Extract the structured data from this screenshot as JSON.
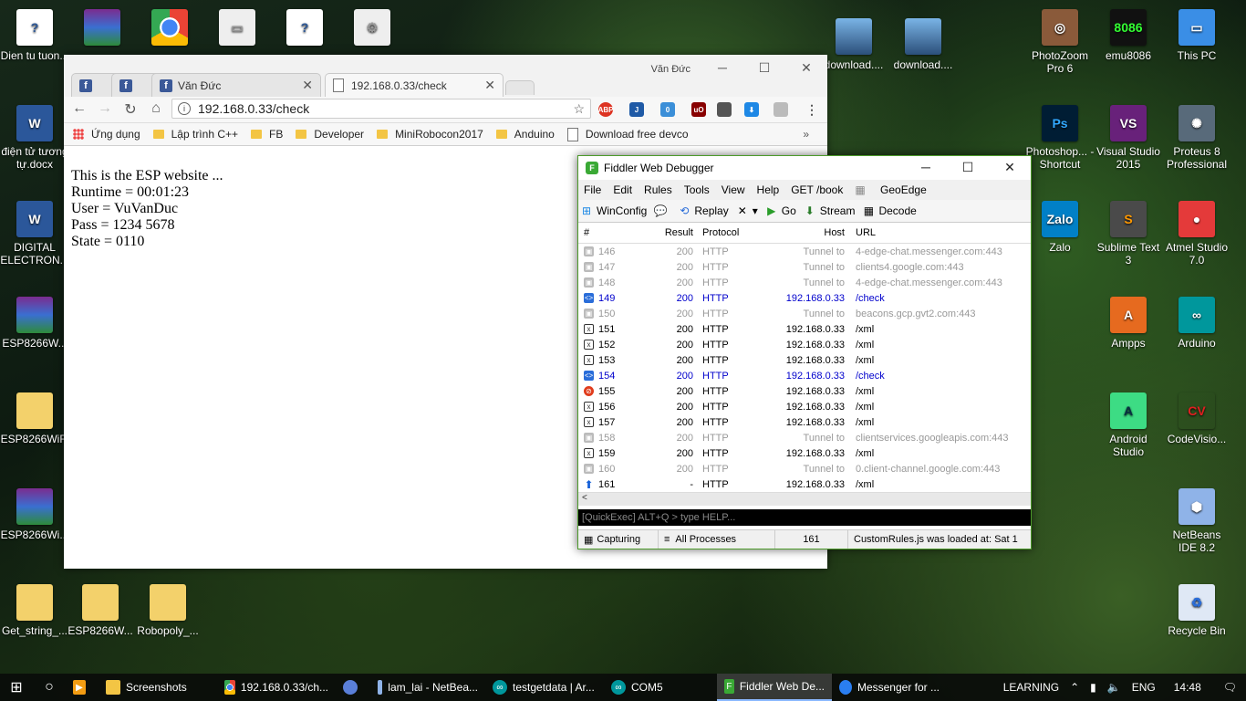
{
  "desktop_left": [
    {
      "label": "Dien tu tuon...",
      "icon": "text-document-icon"
    },
    {
      "label": "điện tử tương tự.docx",
      "icon": "word-document-icon"
    },
    {
      "label": "DIGITAL ELECTRON...",
      "icon": "word-document-icon"
    },
    {
      "label": "ESP8266W...",
      "icon": "winrar-archive-icon"
    },
    {
      "label": "ESP8266WiFi",
      "icon": "folder-icon"
    },
    {
      "label": "ESP8266Wi...",
      "icon": "winrar-archive-icon"
    },
    {
      "label": "Get_string_...",
      "icon": "folder-icon"
    },
    {
      "label": "ESP8266W...",
      "icon": "folder-icon"
    },
    {
      "label": "Robopoly_...",
      "icon": "folder-icon"
    }
  ],
  "desktop_right": [
    {
      "label": "download....",
      "icon": "image-file-icon"
    },
    {
      "label": "download....",
      "icon": "image-file-icon"
    },
    {
      "label": "PhotoZoom Pro 6",
      "icon": "photozoom-icon"
    },
    {
      "label": "emu8086",
      "icon": "emu8086-chip-icon"
    },
    {
      "label": "This PC",
      "icon": "this-pc-icon"
    },
    {
      "label": "Photoshop... - Shortcut",
      "icon": "photoshop-icon"
    },
    {
      "label": "Visual Studio 2015",
      "icon": "visual-studio-icon"
    },
    {
      "label": "Proteus 8 Professional",
      "icon": "proteus-icon"
    },
    {
      "label": "Zalo",
      "icon": "zalo-icon"
    },
    {
      "label": "Sublime Text 3",
      "icon": "sublime-text-icon"
    },
    {
      "label": "Atmel Studio 7.0",
      "icon": "atmel-studio-icon"
    },
    {
      "label": "Ampps",
      "icon": "ampps-icon"
    },
    {
      "label": "Arduino",
      "icon": "arduino-icon"
    },
    {
      "label": "Android Studio",
      "icon": "android-studio-icon"
    },
    {
      "label": "CodeVisio...",
      "icon": "codevision-avr-icon"
    },
    {
      "label": "NetBeans IDE 8.2",
      "icon": "netbeans-icon"
    },
    {
      "label": "Recycle Bin",
      "icon": "recycle-bin-icon"
    }
  ],
  "chrome": {
    "user": "Văn Đức",
    "tabs": [
      {
        "label": "",
        "icon": "facebook-icon"
      },
      {
        "label": "",
        "icon": "facebook-icon"
      },
      {
        "label": "Văn Đức",
        "icon": "facebook-icon"
      },
      {
        "label": "192.168.0.33/check",
        "icon": "page-icon"
      }
    ],
    "url": "192.168.0.33/check",
    "extensions": [
      "ABP",
      "J",
      "0",
      "uO",
      "",
      "",
      ""
    ],
    "bookmarks": [
      {
        "label": "Ứng dụng",
        "icon": "apps-grid-icon"
      },
      {
        "label": "Lập trình C++",
        "icon": "folder-icon"
      },
      {
        "label": "FB",
        "icon": "folder-icon"
      },
      {
        "label": "Developer",
        "icon": "folder-icon"
      },
      {
        "label": "MiniRobocon2017",
        "icon": "folder-icon"
      },
      {
        "label": "Anduino",
        "icon": "folder-icon"
      },
      {
        "label": "Download free devco",
        "icon": "page-icon"
      }
    ],
    "page_lines": [
      "This is the ESP website ...",
      "Runtime = 00:01:23",
      "User = VuVanDuc",
      "Pass = 1234 5678",
      "State = 0110"
    ]
  },
  "fiddler": {
    "title": "Fiddler Web Debugger",
    "menu": [
      "File",
      "Edit",
      "Rules",
      "Tools",
      "View",
      "Help",
      "GET /book",
      "GeoEdge"
    ],
    "toolbar": {
      "winconfig": "WinConfig",
      "replay": "Replay",
      "go": "Go",
      "stream": "Stream",
      "decode": "Decode"
    },
    "columns": [
      "#",
      "Result",
      "Protocol",
      "Host",
      "URL"
    ],
    "rows": [
      {
        "num": "146",
        "result": "200",
        "protocol": "HTTP",
        "host": "Tunnel to",
        "url": "4-edge-chat.messenger.com:443",
        "kind": "tunnel"
      },
      {
        "num": "147",
        "result": "200",
        "protocol": "HTTP",
        "host": "Tunnel to",
        "url": "clients4.google.com:443",
        "kind": "tunnel"
      },
      {
        "num": "148",
        "result": "200",
        "protocol": "HTTP",
        "host": "Tunnel to",
        "url": "4-edge-chat.messenger.com:443",
        "kind": "tunnel"
      },
      {
        "num": "149",
        "result": "200",
        "protocol": "HTTP",
        "host": "192.168.0.33",
        "url": "/check",
        "kind": "link"
      },
      {
        "num": "150",
        "result": "200",
        "protocol": "HTTP",
        "host": "Tunnel to",
        "url": "beacons.gcp.gvt2.com:443",
        "kind": "tunnel"
      },
      {
        "num": "151",
        "result": "200",
        "protocol": "HTTP",
        "host": "192.168.0.33",
        "url": "/xml",
        "kind": "xml"
      },
      {
        "num": "152",
        "result": "200",
        "protocol": "HTTP",
        "host": "192.168.0.33",
        "url": "/xml",
        "kind": "xml"
      },
      {
        "num": "153",
        "result": "200",
        "protocol": "HTTP",
        "host": "192.168.0.33",
        "url": "/xml",
        "kind": "xml"
      },
      {
        "num": "154",
        "result": "200",
        "protocol": "HTTP",
        "host": "192.168.0.33",
        "url": "/check",
        "kind": "link"
      },
      {
        "num": "155",
        "result": "200",
        "protocol": "HTTP",
        "host": "192.168.0.33",
        "url": "/xml",
        "kind": "block"
      },
      {
        "num": "156",
        "result": "200",
        "protocol": "HTTP",
        "host": "192.168.0.33",
        "url": "/xml",
        "kind": "xml"
      },
      {
        "num": "157",
        "result": "200",
        "protocol": "HTTP",
        "host": "192.168.0.33",
        "url": "/xml",
        "kind": "xml"
      },
      {
        "num": "158",
        "result": "200",
        "protocol": "HTTP",
        "host": "Tunnel to",
        "url": "clientservices.googleapis.com:443",
        "kind": "tunnel"
      },
      {
        "num": "159",
        "result": "200",
        "protocol": "HTTP",
        "host": "192.168.0.33",
        "url": "/xml",
        "kind": "xml"
      },
      {
        "num": "160",
        "result": "200",
        "protocol": "HTTP",
        "host": "Tunnel to",
        "url": "0.client-channel.google.com:443",
        "kind": "tunnel"
      },
      {
        "num": "161",
        "result": "-",
        "protocol": "HTTP",
        "host": "192.168.0.33",
        "url": "/xml",
        "kind": "up"
      }
    ],
    "quickexec_placeholder": "[QuickExec] ALT+Q > type HELP...",
    "status": {
      "capturing": "Capturing",
      "processes": "All Processes",
      "count": "161",
      "message": "CustomRules.js was loaded at: Sat 1"
    }
  },
  "taskbar": {
    "items": [
      {
        "label": "Screenshots",
        "icon": "folder-icon"
      },
      {
        "label": "192.168.0.33/ch...",
        "icon": "chrome-icon"
      },
      {
        "label": "",
        "icon": "chrome-canary-icon"
      },
      {
        "label": "lam_lai - NetBea...",
        "icon": "netbeans-icon"
      },
      {
        "label": "testgetdata | Ar...",
        "icon": "arduino-icon"
      },
      {
        "label": "COM5",
        "icon": "arduino-icon"
      },
      {
        "label": "Fiddler Web De...",
        "icon": "fiddler-icon"
      },
      {
        "label": "Messenger for ...",
        "icon": "messenger-icon"
      }
    ],
    "tray": {
      "lang_bar": "LEARNING",
      "lang": "ENG",
      "time": "14:48"
    }
  }
}
